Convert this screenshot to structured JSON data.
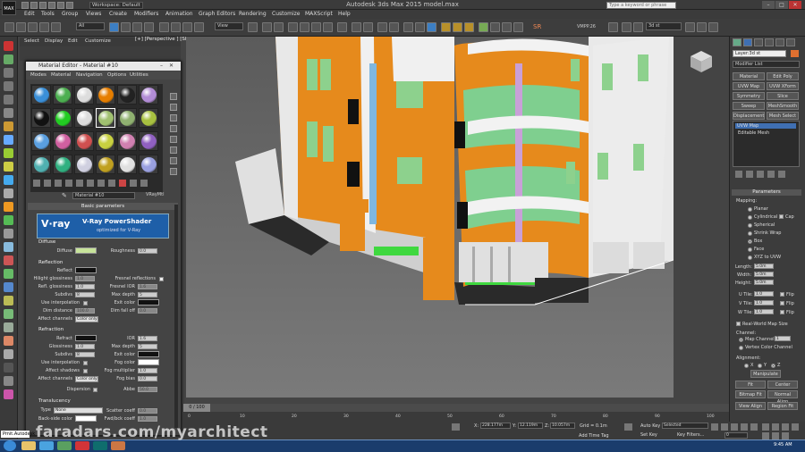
{
  "window": {
    "title": "Autodesk 3ds Max 2015     model.max",
    "workspace": "Workspace: Default",
    "search_placeholder": "Type a keyword or phrase",
    "minimize": "–",
    "maximize": "□",
    "close": "✕",
    "logo": "MAX"
  },
  "menubar": [
    "Edit",
    "Tools",
    "Group",
    "Views",
    "Create",
    "Modifiers",
    "Animation",
    "Graph Editors",
    "Rendering",
    "Customize",
    "MAXScript",
    "Help"
  ],
  "toolbar": {
    "selection_filter": "All",
    "reference_coord": "View",
    "named_selection": "3d st",
    "sr_label": "SR",
    "vmp_label": "VMPP.26"
  },
  "scene_explorer": {
    "tabs": [
      "Select",
      "Display",
      "Edit",
      "Customize"
    ]
  },
  "viewport": {
    "label": "[+] [Perspective ] [Shaded ]"
  },
  "material_editor": {
    "title": "Material Editor - Material #10",
    "menu": [
      "Modes",
      "Material",
      "Navigation",
      "Options",
      "Utilities"
    ],
    "material_name": "Material #10",
    "material_type": "VRayMtl",
    "rollout": "Basic parameters",
    "banner": {
      "logo": "V·ray",
      "title": "V-Ray PowerShader",
      "subtitle": "optimized for V-Ray"
    },
    "slot_colors": [
      "#3a8fd8",
      "#4caf50",
      "#dddddd",
      "#e67e00",
      "#222222",
      "#b28cd6",
      "#111111",
      "#22cc22",
      "#dddddd",
      "#a0c070",
      "#8fb070",
      "#a8c040",
      "#5a9fe0",
      "#d060a0",
      "#d05050",
      "#c8d040",
      "#d080b0",
      "#9060c0",
      "#50b0b0",
      "#30b080",
      "#d0d0e0",
      "#c0a020",
      "#e0e0e0",
      "#9aa0e0"
    ],
    "diffuse": {
      "section": "Diffuse",
      "diffuse_label": "Diffuse",
      "roughness_label": "Roughness",
      "roughness": "0.0"
    },
    "reflection": {
      "section": "Reflection",
      "reflect": "Reflect",
      "hilight_gloss": "Hilight glossiness",
      "hilight_gloss_val": "1.0",
      "refl_gloss": "Refl. glossiness",
      "refl_gloss_val": "1.0",
      "subdivs": "Subdivs",
      "subdivs_val": "8",
      "use_interp": "Use interpolation",
      "dim_distance": "Dim distance",
      "dim_distance_val": "100.0",
      "affect_channels": "Affect channels",
      "affect_channels_val": "Color only",
      "fresnel": "Fresnel reflections",
      "fresnel_ior": "Fresnel IOR",
      "fresnel_ior_val": "1.6",
      "max_depth": "Max depth",
      "max_depth_val": "5",
      "exit_color": "Exit color",
      "dim_falloff": "Dim fall off",
      "dim_falloff_val": "0.0"
    },
    "refraction": {
      "section": "Refraction",
      "refract": "Refract",
      "glossiness": "Glossiness",
      "glossiness_val": "1.0",
      "subdivs": "Subdivs",
      "subdivs_val": "8",
      "use_interp": "Use interpolation",
      "affect_shadows": "Affect shadows",
      "affect_channels": "Affect channels",
      "affect_channels_val": "Color only",
      "dispersion": "Dispersion",
      "ior": "IOR",
      "ior_val": "1.6",
      "max_depth": "Max depth",
      "max_depth_val": "5",
      "exit_color": "Exit color",
      "fog_color": "Fog color",
      "fog_mult": "Fog multiplier",
      "fog_mult_val": "1.0",
      "fog_bias": "Fog bias",
      "fog_bias_val": "0.0",
      "abbe": "Abbe",
      "abbe_val": "50.0"
    },
    "translucency": {
      "section": "Translucency",
      "type": "Type",
      "type_val": "None",
      "back_side": "Back-side color",
      "scatter": "Scatter coeff",
      "scatter_val": "0.0",
      "fwd_bck": "Fwd/bck coeff",
      "fwd_bck_val": "1.0"
    }
  },
  "command_panel": {
    "object_name": "Layer:3d st",
    "modifier_list": "Modifier List",
    "buttons": [
      "Material",
      "Edit Poly",
      "UVW Map",
      "UVW XForm",
      "Symmetry",
      "Slice",
      "Sweep",
      "MeshSmooth",
      "Displacement",
      "Mesh Select"
    ],
    "stack": [
      "UVW Map",
      "Editable Mesh"
    ],
    "parameters": "Parameters",
    "mapping_label": "Mapping:",
    "mapping": [
      "Planar",
      "Cylindrical",
      "Spherical",
      "Shrink Wrap",
      "Box",
      "Face",
      "XYZ to UVW"
    ],
    "mapping_selected": "Box",
    "cap": "Cap",
    "length_label": "Length:",
    "length": "5.0m",
    "width_label": "Width:",
    "width": "5.0m",
    "height_label": "Height:",
    "height": "5.0m",
    "u_tile": "U Tile:",
    "u_tile_val": "1.0",
    "v_tile": "V Tile:",
    "v_tile_val": "1.0",
    "w_tile": "W Tile:",
    "w_tile_val": "1.0",
    "flip": "Flip",
    "real_world": "Real-World Map Size",
    "channel_label": "Channel:",
    "map_channel": "Map Channel:",
    "map_channel_val": "1",
    "vertex_color": "Vertex Color Channel",
    "alignment_label": "Alignment:",
    "axes": [
      "X",
      "Y",
      "Z"
    ],
    "manipulate": "Manipulate",
    "fit": "Fit",
    "center": "Center",
    "bitmap_fit": "Bitmap Fit",
    "normal_align": "Normal Align",
    "view_align": "View Align",
    "region_fit": "Region Fit"
  },
  "timeline": {
    "frame": "0 / 100",
    "ticks": [
      "0",
      "10",
      "20",
      "30",
      "40",
      "50",
      "60",
      "70",
      "80",
      "90",
      "100"
    ]
  },
  "statusbar": {
    "listener": "Pmit.Autodesk",
    "x": "228.177m",
    "y": "12.119m",
    "z": "10.057m",
    "grid": "Grid = 0.1m",
    "add_time_tag": "Add Time Tag",
    "auto_key": "Auto Key",
    "selected": "Selected",
    "set_key": "Set Key",
    "key_filters": "Key Filters...",
    "frame_field": "0"
  },
  "watermark": "faradars.com/myarchitect",
  "taskbar": {
    "clock": "9:45 AM"
  }
}
